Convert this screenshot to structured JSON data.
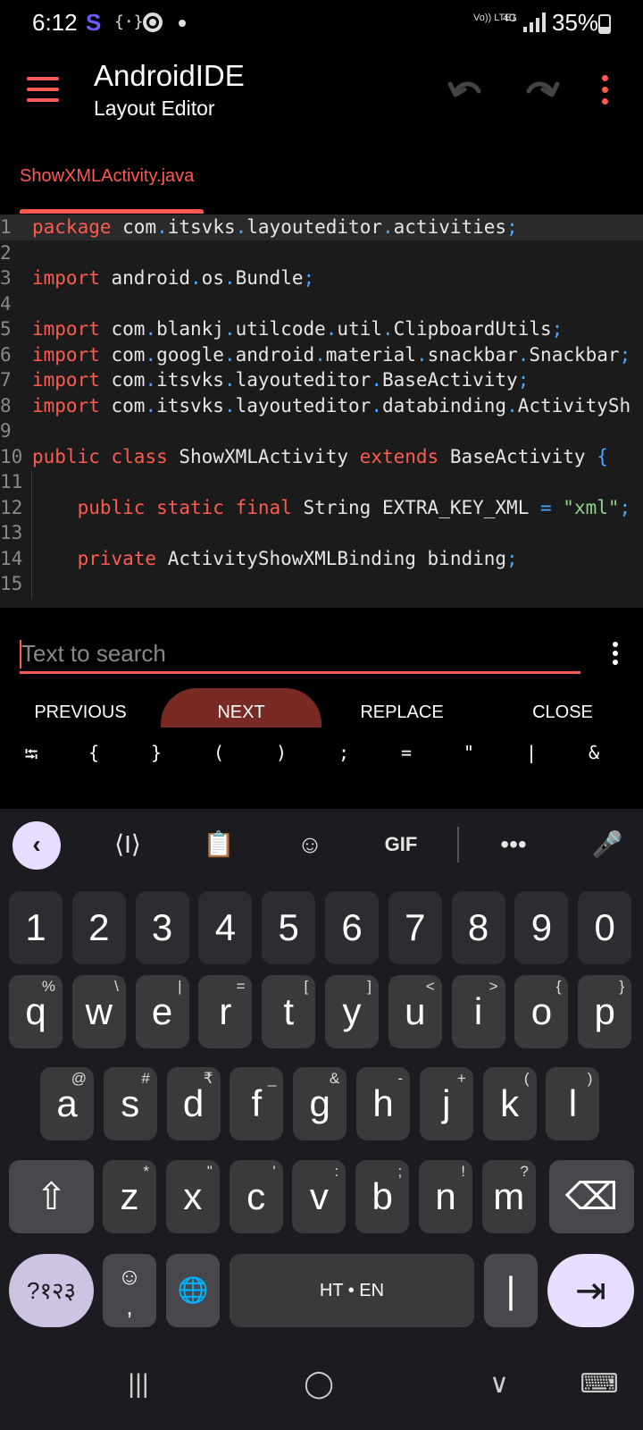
{
  "status_bar": {
    "time": "6:12",
    "app_badge": "S",
    "dev_glyph": "{·}",
    "volte_label": "Vo)) LTE1",
    "network_label": "4G",
    "battery": "35%"
  },
  "toolbar": {
    "title": "AndroidIDE",
    "subtitle": "Layout Editor"
  },
  "tabs": [
    {
      "label": "ShowXMLActivity.java",
      "active": true
    }
  ],
  "editor": {
    "lines": [
      {
        "n": "1",
        "segments": [
          [
            "kw",
            "package"
          ],
          [
            "",
            ""
          ],
          [
            "",
            " com"
          ],
          [
            "pt",
            "."
          ],
          [
            "",
            "itsvks"
          ],
          [
            "pt",
            "."
          ],
          [
            "",
            "layouteditor"
          ],
          [
            "pt",
            "."
          ],
          [
            "",
            "activities"
          ],
          [
            "pt",
            ";"
          ]
        ]
      },
      {
        "n": "2",
        "segments": []
      },
      {
        "n": "3",
        "segments": [
          [
            "kw",
            "import"
          ],
          [
            "",
            " android"
          ],
          [
            "pt",
            "."
          ],
          [
            "",
            "os"
          ],
          [
            "pt",
            "."
          ],
          [
            "",
            "Bundle"
          ],
          [
            "pt",
            ";"
          ]
        ]
      },
      {
        "n": "4",
        "segments": []
      },
      {
        "n": "5",
        "segments": [
          [
            "kw",
            "import"
          ],
          [
            "",
            " com"
          ],
          [
            "pt",
            "."
          ],
          [
            "",
            "blankj"
          ],
          [
            "pt",
            "."
          ],
          [
            "",
            "utilcode"
          ],
          [
            "pt",
            "."
          ],
          [
            "",
            "util"
          ],
          [
            "pt",
            "."
          ],
          [
            "",
            "ClipboardUtils"
          ],
          [
            "pt",
            ";"
          ]
        ]
      },
      {
        "n": "6",
        "segments": [
          [
            "kw",
            "import"
          ],
          [
            "",
            " com"
          ],
          [
            "pt",
            "."
          ],
          [
            "",
            "google"
          ],
          [
            "pt",
            "."
          ],
          [
            "",
            "android"
          ],
          [
            "pt",
            "."
          ],
          [
            "",
            "material"
          ],
          [
            "pt",
            "."
          ],
          [
            "",
            "snackbar"
          ],
          [
            "pt",
            "."
          ],
          [
            "",
            "Snackbar"
          ],
          [
            "pt",
            ";"
          ]
        ]
      },
      {
        "n": "7",
        "segments": [
          [
            "kw",
            "import"
          ],
          [
            "",
            " com"
          ],
          [
            "pt",
            "."
          ],
          [
            "",
            "itsvks"
          ],
          [
            "pt",
            "."
          ],
          [
            "",
            "layouteditor"
          ],
          [
            "pt",
            "."
          ],
          [
            "",
            "BaseActivity"
          ],
          [
            "pt",
            ";"
          ]
        ]
      },
      {
        "n": "8",
        "segments": [
          [
            "kw",
            "import"
          ],
          [
            "",
            " com"
          ],
          [
            "pt",
            "."
          ],
          [
            "",
            "itsvks"
          ],
          [
            "pt",
            "."
          ],
          [
            "",
            "layouteditor"
          ],
          [
            "pt",
            "."
          ],
          [
            "",
            "databinding"
          ],
          [
            "pt",
            "."
          ],
          [
            "",
            "ActivitySh"
          ]
        ]
      },
      {
        "n": "9",
        "segments": []
      },
      {
        "n": "10",
        "segments": [
          [
            "kw",
            "public"
          ],
          [
            "",
            " "
          ],
          [
            "kw",
            "class"
          ],
          [
            "",
            " ShowXMLActivity "
          ],
          [
            "kw",
            "extends"
          ],
          [
            "",
            " BaseActivity "
          ],
          [
            "pt",
            "{"
          ]
        ]
      },
      {
        "n": "11",
        "segments": []
      },
      {
        "n": "12",
        "segments": [
          [
            "",
            "    "
          ],
          [
            "kw",
            "public"
          ],
          [
            "",
            " "
          ],
          [
            "kw",
            "static"
          ],
          [
            "",
            " "
          ],
          [
            "kw",
            "final"
          ],
          [
            "",
            " String EXTRA_KEY_XML "
          ],
          [
            "pt",
            "="
          ],
          [
            "",
            " "
          ],
          [
            "st",
            "\"xml\""
          ],
          [
            "pt",
            ";"
          ]
        ]
      },
      {
        "n": "13",
        "segments": []
      },
      {
        "n": "14",
        "segments": [
          [
            "",
            "    "
          ],
          [
            "kw",
            "private"
          ],
          [
            "",
            " ActivityShowXMLBinding binding"
          ],
          [
            "pt",
            ";"
          ]
        ]
      },
      {
        "n": "15",
        "segments": []
      }
    ]
  },
  "search": {
    "placeholder": "Text to search",
    "buttons": {
      "previous": "PREVIOUS",
      "next": "NEXT",
      "replace": "REPLACE",
      "close": "CLOSE"
    },
    "symbols": [
      "⭾",
      "{",
      "}",
      "(",
      ")",
      ";",
      "=",
      "\"",
      "|",
      "&"
    ]
  },
  "keyboard": {
    "toolbar": {
      "back": "‹",
      "cursor": "⟨I⟩",
      "clipboard": "📋",
      "sticker": "☺",
      "gif": "GIF",
      "more": "•••",
      "mic": "🎤"
    },
    "number_row": [
      "1",
      "2",
      "3",
      "4",
      "5",
      "6",
      "7",
      "8",
      "9",
      "0"
    ],
    "row1": [
      {
        "k": "q",
        "h": "%"
      },
      {
        "k": "w",
        "h": "\\"
      },
      {
        "k": "e",
        "h": "|"
      },
      {
        "k": "r",
        "h": "="
      },
      {
        "k": "t",
        "h": "["
      },
      {
        "k": "y",
        "h": "]"
      },
      {
        "k": "u",
        "h": "<"
      },
      {
        "k": "i",
        "h": ">"
      },
      {
        "k": "o",
        "h": "{"
      },
      {
        "k": "p",
        "h": "}"
      }
    ],
    "row2": [
      {
        "k": "a",
        "h": "@"
      },
      {
        "k": "s",
        "h": "#"
      },
      {
        "k": "d",
        "h": "₹"
      },
      {
        "k": "f",
        "h": "_"
      },
      {
        "k": "g",
        "h": "&"
      },
      {
        "k": "h",
        "h": "-"
      },
      {
        "k": "j",
        "h": "+"
      },
      {
        "k": "k",
        "h": "("
      },
      {
        "k": "l",
        "h": ")"
      }
    ],
    "row3": [
      {
        "k": "z",
        "h": "*"
      },
      {
        "k": "x",
        "h": "\""
      },
      {
        "k": "c",
        "h": "'"
      },
      {
        "k": "v",
        "h": ":"
      },
      {
        "k": "b",
        "h": ";"
      },
      {
        "k": "n",
        "h": "!"
      },
      {
        "k": "m",
        "h": "?"
      }
    ],
    "shift": "⇧",
    "backspace": "⌫",
    "symbols_key": "?१२३",
    "emoji_key_top": "☺",
    "emoji_key_bottom": ",",
    "globe": "🌐",
    "space_label": "HT • EN",
    "period_key": "|",
    "enter": "⇥"
  },
  "navbar": {
    "recents": "|||",
    "home": "◯",
    "back": "∨",
    "keyboard_switch": "⌨"
  }
}
